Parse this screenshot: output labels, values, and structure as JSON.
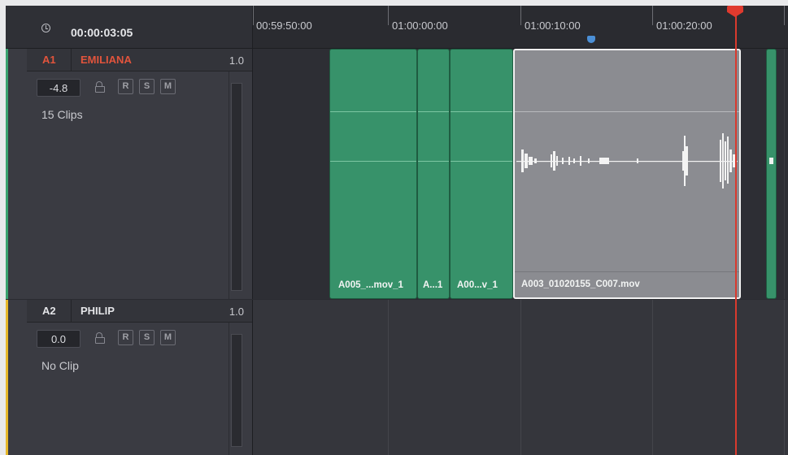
{
  "header": {
    "timecode": "00:00:03:05"
  },
  "ruler": {
    "labels": [
      "00:59:50:00",
      "01:00:00:00",
      "01:00:10:00",
      "01:00:20:00"
    ]
  },
  "tracks": [
    {
      "id": "A1",
      "name": "EMILIANA",
      "level": "1.0",
      "volume": "-4.8",
      "buttons": [
        "R",
        "S",
        "M"
      ],
      "clip_count": "15 Clips",
      "color": "#3aa36f",
      "label_color": "#e2543c",
      "clips": [
        "A005_...mov_1",
        "A...1",
        "A00...v_1",
        "A003_01020155_C007.mov"
      ]
    },
    {
      "id": "A2",
      "name": "PHILIP",
      "level": "1.0",
      "volume": "0.0",
      "buttons": [
        "R",
        "S",
        "M"
      ],
      "clip_count": "No Clip",
      "color": "#e7b82b",
      "label_color": "#e4e5e8",
      "clips": []
    }
  ],
  "colors": {
    "playhead": "#e03a2e",
    "marker": "#4b8fd6",
    "clip_green": "#37926a",
    "clip_selected": "#8b8c91"
  }
}
